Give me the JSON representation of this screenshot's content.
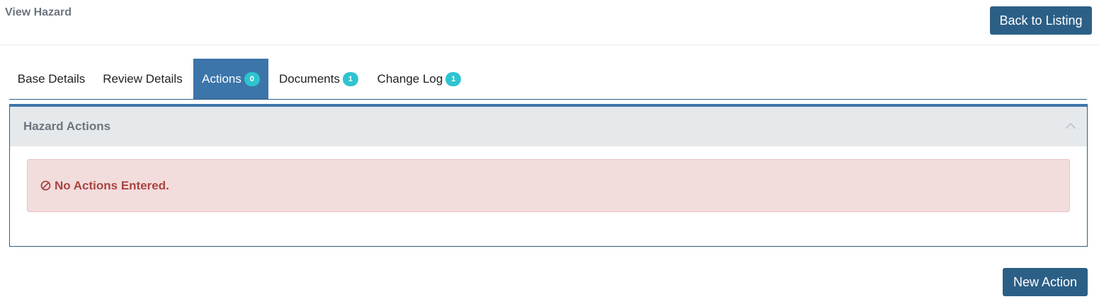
{
  "header": {
    "title": "View Hazard",
    "back_label": "Back to Listing"
  },
  "tabs": [
    {
      "label": "Base Details",
      "badge": null,
      "active": false
    },
    {
      "label": "Review Details",
      "badge": null,
      "active": false
    },
    {
      "label": "Actions",
      "badge": "0",
      "active": true
    },
    {
      "label": "Documents",
      "badge": "1",
      "active": false
    },
    {
      "label": "Change Log",
      "badge": "1",
      "active": false
    }
  ],
  "panel": {
    "title": "Hazard Actions",
    "collapse_icon": "chevron-up-icon",
    "alert": {
      "icon": "ban-icon",
      "text": "No Actions Entered."
    }
  },
  "footer": {
    "new_action_label": "New Action"
  },
  "colors": {
    "primary_button": "#2c5f86",
    "active_tab": "#3c75aa",
    "badge": "#2ec4cf",
    "alert_bg": "#f2dcdc",
    "alert_text": "#a94442"
  }
}
